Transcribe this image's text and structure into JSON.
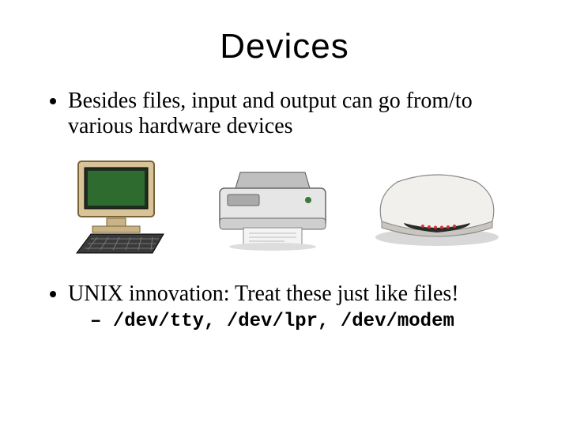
{
  "slide": {
    "title": "Devices",
    "bullet1": "Besides files, input and output can go from/to various hardware devices",
    "bullet2": "UNIX innovation: Treat these just like files!",
    "sub1": "/dev/tty, /dev/lpr, /dev/modem",
    "images": {
      "computer_alt": "computer-with-keyboard",
      "printer_alt": "printer",
      "modem_alt": "modem"
    }
  }
}
